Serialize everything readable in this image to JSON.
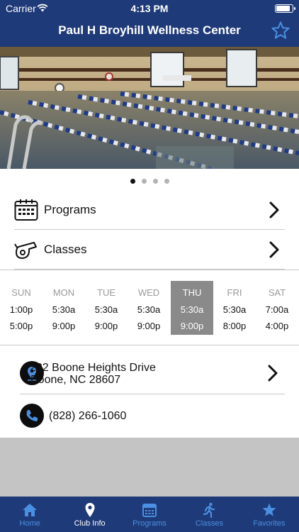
{
  "status_bar": {
    "carrier": "Carrier",
    "time": "4:13 PM",
    "battery_percent": 95
  },
  "header": {
    "title": "Paul H Broyhill Wellness Center",
    "favorite_icon": "star-outline-icon"
  },
  "carousel": {
    "page_count": 4,
    "active_index": 0,
    "image": "indoor lap pool photo"
  },
  "menu": [
    {
      "label": "Programs",
      "icon": "calendar-icon"
    },
    {
      "label": "Classes",
      "icon": "whistle-icon"
    }
  ],
  "hours": {
    "active_day": "THU",
    "days": [
      {
        "name": "SUN",
        "open": "1:00p",
        "close": "5:00p"
      },
      {
        "name": "MON",
        "open": "5:30a",
        "close": "9:00p"
      },
      {
        "name": "TUE",
        "open": "5:30a",
        "close": "9:00p"
      },
      {
        "name": "WED",
        "open": "5:30a",
        "close": "9:00p"
      },
      {
        "name": "THU",
        "open": "5:30a",
        "close": "9:00p"
      },
      {
        "name": "FRI",
        "open": "5:30a",
        "close": "8:00p"
      },
      {
        "name": "SAT",
        "open": "7:00a",
        "close": "4:00p"
      }
    ]
  },
  "contact": {
    "address_line1": "232 Boone Heights Drive",
    "address_line2": "Boone, NC 28607",
    "phone": "(828) 266-1060"
  },
  "tabbar": {
    "active": "Club Info",
    "tabs": [
      {
        "label": "Home",
        "icon": "home-icon"
      },
      {
        "label": "Club Info",
        "icon": "location-pin-icon"
      },
      {
        "label": "Programs",
        "icon": "calendar-icon"
      },
      {
        "label": "Classes",
        "icon": "runner-icon"
      },
      {
        "label": "Favorites",
        "icon": "star-icon"
      }
    ]
  },
  "colors": {
    "header": "#1f3a78",
    "accent": "#4a90e2",
    "active_day": "#8a8a8a"
  }
}
